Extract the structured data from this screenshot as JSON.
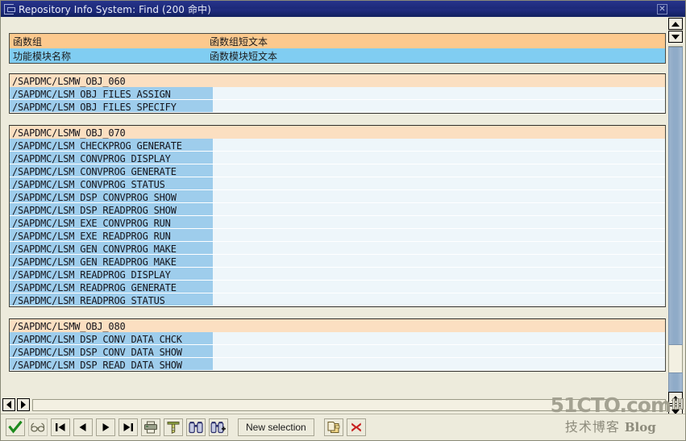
{
  "window": {
    "title": "Repository Info System: Find (200 命中)",
    "icon": "window-menu-icon",
    "close_label": "✕"
  },
  "headers": {
    "group_col1": "函数组",
    "group_col2": "函数组短文本",
    "module_col1": "功能模块名称",
    "module_col2": "函数模块短文本"
  },
  "colors": {
    "group_header_bg": "#fcc98e",
    "module_header_bg": "#80cdf2",
    "group_row_bg": "#fbdfc1",
    "module_row_bg": "#9ecdec",
    "module_row_tail_bg": "#eef6fa",
    "titlebar": "#1d2a7a",
    "scrollbar_thumb": "#8fabc8"
  },
  "groups": [
    {
      "name": "/SAPDMC/LSMW_OBJ_060",
      "modules": [
        "/SAPDMC/LSM_OBJ_FILES_ASSIGN",
        "/SAPDMC/LSM_OBJ_FILES_SPECIFY"
      ]
    },
    {
      "name": "/SAPDMC/LSMW_OBJ_070",
      "modules": [
        "/SAPDMC/LSM_CHECKPROG_GENERATE",
        "/SAPDMC/LSM_CONVPROG_DISPLAY",
        "/SAPDMC/LSM_CONVPROG_GENERATE",
        "/SAPDMC/LSM_CONVPROG_STATUS",
        "/SAPDMC/LSM_DSP_CONVPROG_SHOW",
        "/SAPDMC/LSM_DSP_READPROG_SHOW",
        "/SAPDMC/LSM_EXE_CONVPROG_RUN",
        "/SAPDMC/LSM_EXE_READPROG_RUN",
        "/SAPDMC/LSM_GEN_CONVPROG_MAKE",
        "/SAPDMC/LSM_GEN_READPROG_MAKE",
        "/SAPDMC/LSM_READPROG_DISPLAY",
        "/SAPDMC/LSM_READPROG_GENERATE",
        "/SAPDMC/LSM_READPROG_STATUS"
      ]
    },
    {
      "name": "/SAPDMC/LSMW_OBJ_080",
      "modules": [
        "/SAPDMC/LSM_DSP_CONV_DATA_CHCK",
        "/SAPDMC/LSM_DSP_CONV_DATA_SHOW",
        "/SAPDMC/LSM_DSP_READ_DATA_SHOW"
      ]
    }
  ],
  "toolbar": {
    "buttons": [
      {
        "name": "continue-check-button",
        "icon": "green-check-icon"
      },
      {
        "name": "display-glasses-button",
        "icon": "glasses-icon"
      },
      {
        "name": "first-page-button",
        "icon": "first-page-icon"
      },
      {
        "name": "previous-page-button",
        "icon": "previous-page-icon"
      },
      {
        "name": "next-page-button",
        "icon": "next-page-icon"
      },
      {
        "name": "last-page-button",
        "icon": "last-page-icon"
      },
      {
        "name": "print-button",
        "icon": "printer-icon"
      },
      {
        "name": "filter-button",
        "icon": "funnel-filter-icon"
      },
      {
        "name": "find-button",
        "icon": "binoculars-icon"
      },
      {
        "name": "find-next-button",
        "icon": "binoculars-plus-icon"
      }
    ],
    "new_selection_label": "New selection",
    "copy_button": {
      "name": "copy-button",
      "icon": "copy-icon"
    },
    "cancel_button": {
      "name": "cancel-button",
      "icon": "red-x-icon"
    }
  },
  "watermark": {
    "site": "51CTO.com",
    "cn": "技术博客",
    "blog": "Blog"
  }
}
